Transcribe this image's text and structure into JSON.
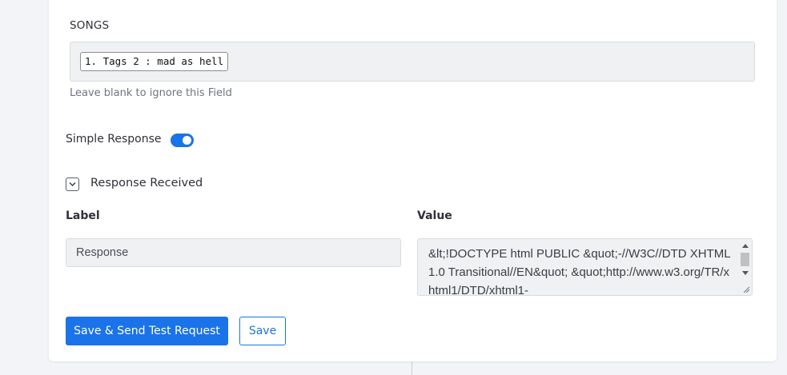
{
  "songs_field": {
    "label": "SONGS",
    "tag": "1. Tags 2 : mad as hell",
    "help": "Leave blank to ignore this Field"
  },
  "simple_response": {
    "label": "Simple Response",
    "enabled": true
  },
  "response_section": {
    "title": "Response Received",
    "expanded": true,
    "label_header": "Label",
    "value_header": "Value",
    "label_value": "Response",
    "value_text": "&lt;!DOCTYPE html PUBLIC &quot;-//W3C//DTD XHTML 1.0 Transitional//EN&quot; &quot;http://www.w3.org/TR/xhtml1/DTD/xhtml1-"
  },
  "actions": {
    "save_send_label": "Save & Send Test Request",
    "save_label": "Save"
  },
  "colors": {
    "accent": "#1a73e8"
  }
}
